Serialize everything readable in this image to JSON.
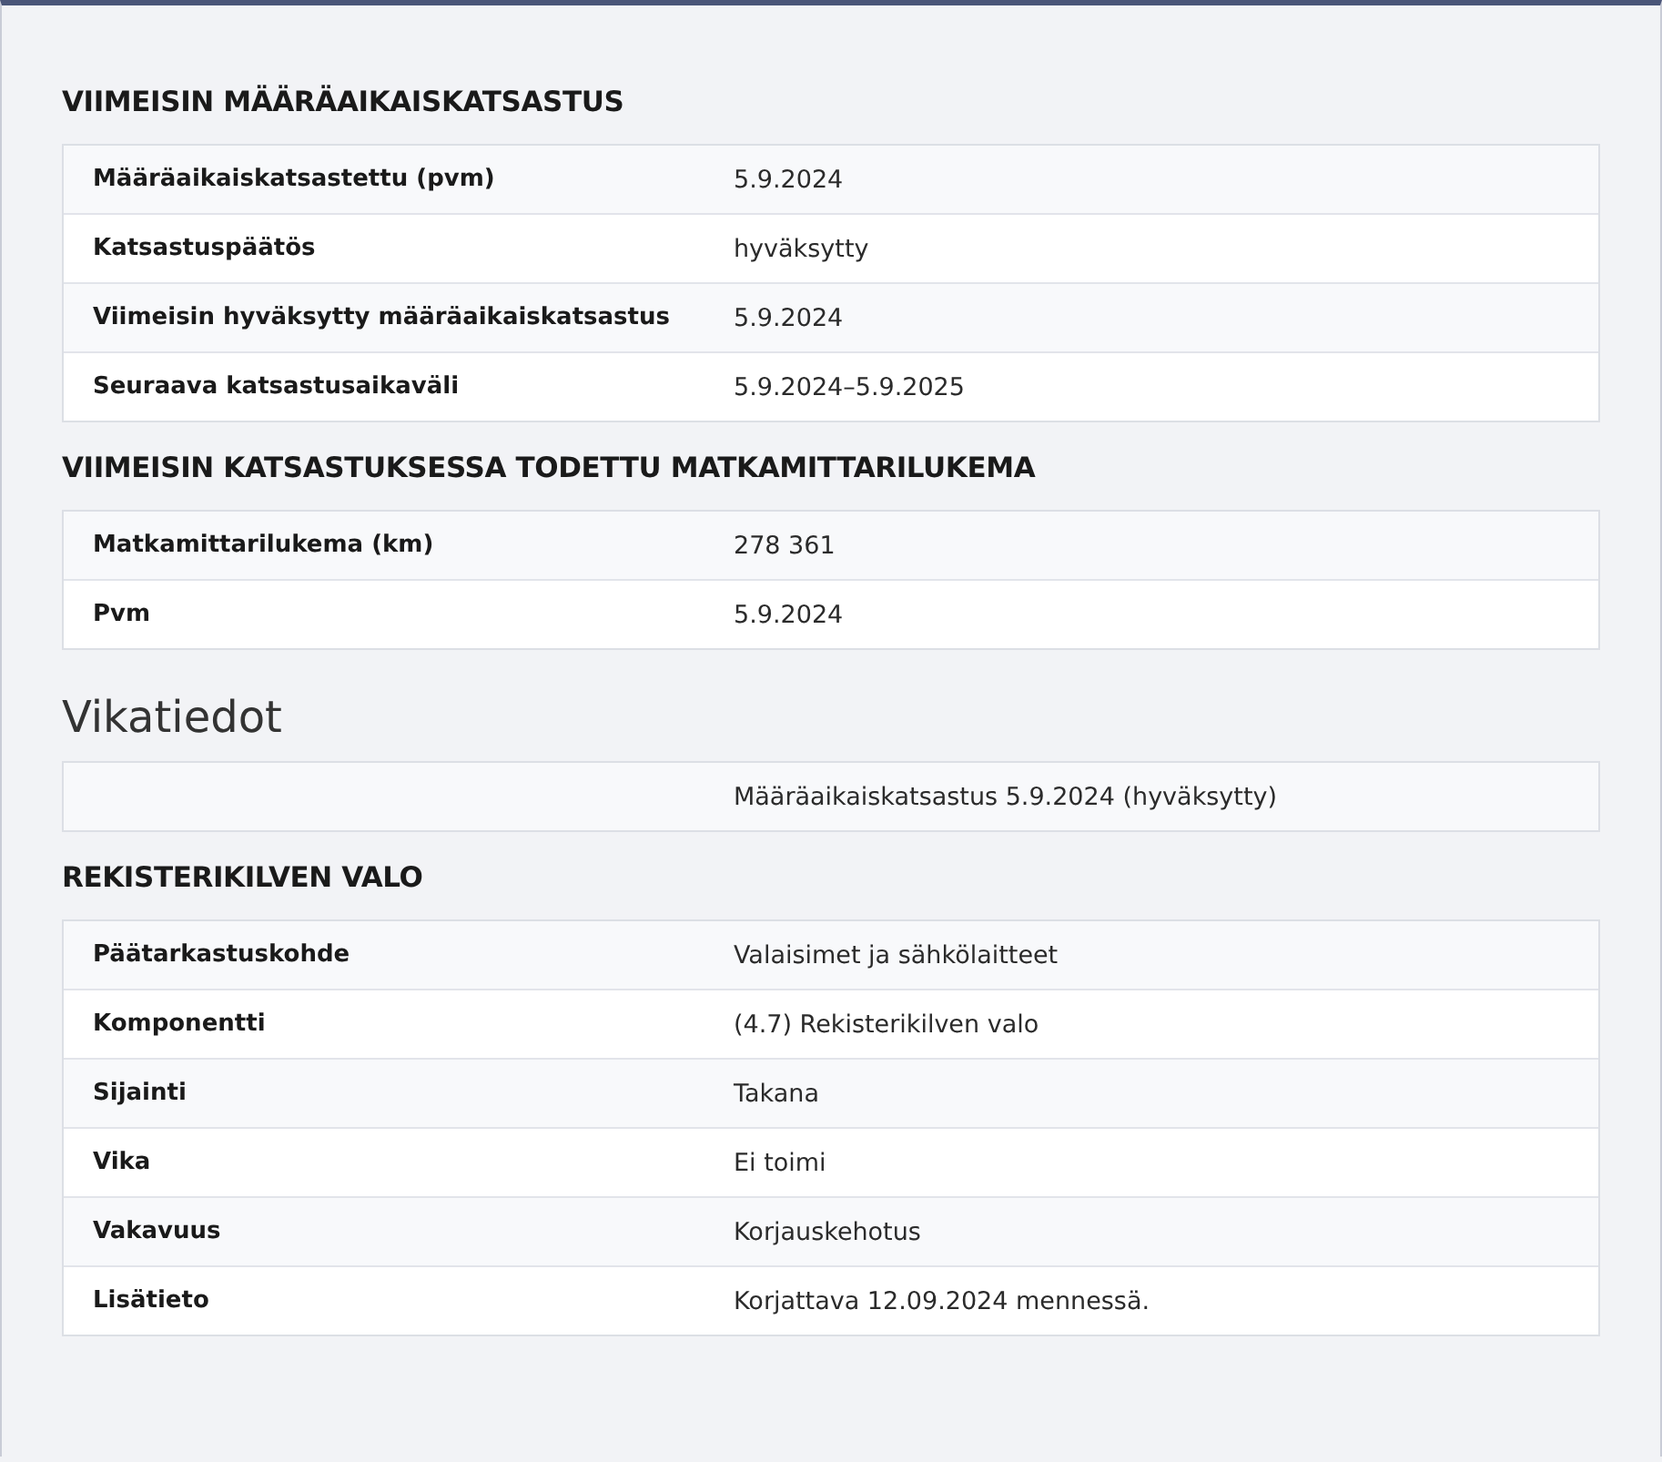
{
  "blocks": [
    {
      "kind": "heading",
      "text": "VIIMEISIN MÄÄRÄAIKAISKATSASTUS"
    },
    {
      "kind": "table",
      "rows": [
        {
          "label": "Määräaikaiskatsastettu (pvm)",
          "value": "5.9.2024"
        },
        {
          "label": "Katsastuspäätös",
          "value": "hyväksytty"
        },
        {
          "label": "Viimeisin hyväksytty määräaikaiskatsastus",
          "value": "5.9.2024"
        },
        {
          "label": "Seuraava katsastusaikaväli",
          "value": "5.9.2024–5.9.2025"
        }
      ]
    },
    {
      "kind": "heading",
      "text": "VIIMEISIN KATSASTUKSESSA TODETTU MATKAMITTARILUKEMA"
    },
    {
      "kind": "table",
      "rows": [
        {
          "label": "Matkamittarilukema (km)",
          "value": "278 361"
        },
        {
          "label": "Pvm",
          "value": "5.9.2024"
        }
      ]
    },
    {
      "kind": "title",
      "text": "Vikatiedot"
    },
    {
      "kind": "table",
      "rows": [
        {
          "value": "Määräaikaiskatsastus 5.9.2024 (hyväksytty)"
        }
      ]
    },
    {
      "kind": "heading",
      "text": "REKISTERIKILVEN VALO"
    },
    {
      "kind": "table",
      "rows": [
        {
          "label": "Päätarkastuskohde",
          "value": "Valaisimet ja sähkölaitteet"
        },
        {
          "label": "Komponentti",
          "value": "(4.7) Rekisterikilven valo"
        },
        {
          "label": "Sijainti",
          "value": "Takana"
        },
        {
          "label": "Vika",
          "value": "Ei toimi"
        },
        {
          "label": "Vakavuus",
          "value": "Korjauskehotus"
        },
        {
          "label": "Lisätieto",
          "value": "Korjattava 12.09.2024 mennessä."
        }
      ]
    }
  ]
}
